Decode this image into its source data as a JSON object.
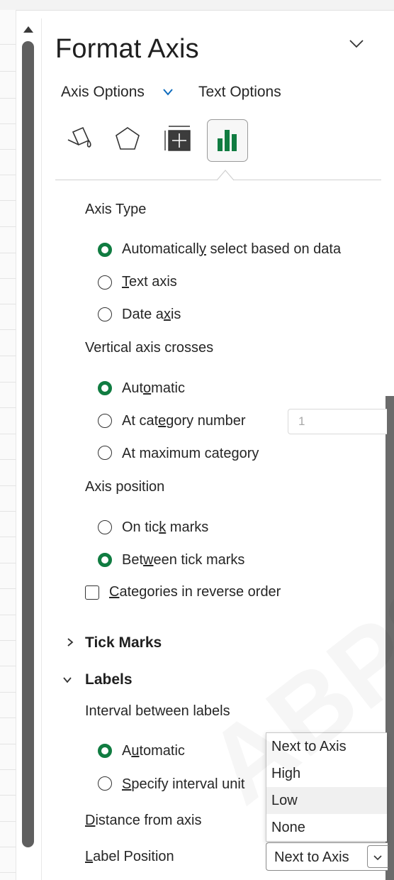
{
  "panel": {
    "title": "Format Axis",
    "tabs": {
      "axis_options": "Axis Options",
      "text_options": "Text Options"
    },
    "icon_tabs": [
      "fill-line-icon",
      "effects-icon",
      "size-properties-icon",
      "axis-options-icon"
    ]
  },
  "axis_type": {
    "heading": "Axis Type",
    "options": [
      {
        "pre": "Automatically",
        "u": "",
        "post": "",
        "full": "Automatically select based on data",
        "selected": true
      },
      {
        "full": "Text axis",
        "selected": false
      },
      {
        "full": "Date axis",
        "selected": false
      }
    ]
  },
  "vertical_axis_crosses": {
    "heading": "Vertical axis crosses",
    "options": [
      {
        "full": "Automatic",
        "selected": true
      },
      {
        "full": "At category number",
        "selected": false,
        "input_placeholder": "1"
      },
      {
        "full": "At maximum category",
        "selected": false
      }
    ]
  },
  "axis_position": {
    "heading": "Axis position",
    "options": [
      {
        "full": "On tick marks",
        "selected": false
      },
      {
        "full": "Between tick marks",
        "selected": true
      }
    ]
  },
  "reverse_order": {
    "label": "Categories in reverse order",
    "checked": false
  },
  "sections": {
    "tick_marks": "Tick Marks",
    "labels": "Labels"
  },
  "labels": {
    "interval_heading": "Interval between labels",
    "options": [
      {
        "full": "Automatic",
        "selected": true
      },
      {
        "full": "Specify interval unit",
        "selected": false
      }
    ],
    "distance_label": "Distance from axis",
    "position_label": "Label Position",
    "position_value": "Next to Axis",
    "position_options": [
      "Next to Axis",
      "High",
      "Low",
      "None"
    ]
  },
  "colors": {
    "accent": "#107c41",
    "link_blue": "#0f6cbd"
  },
  "watermark": "ABPSYC"
}
